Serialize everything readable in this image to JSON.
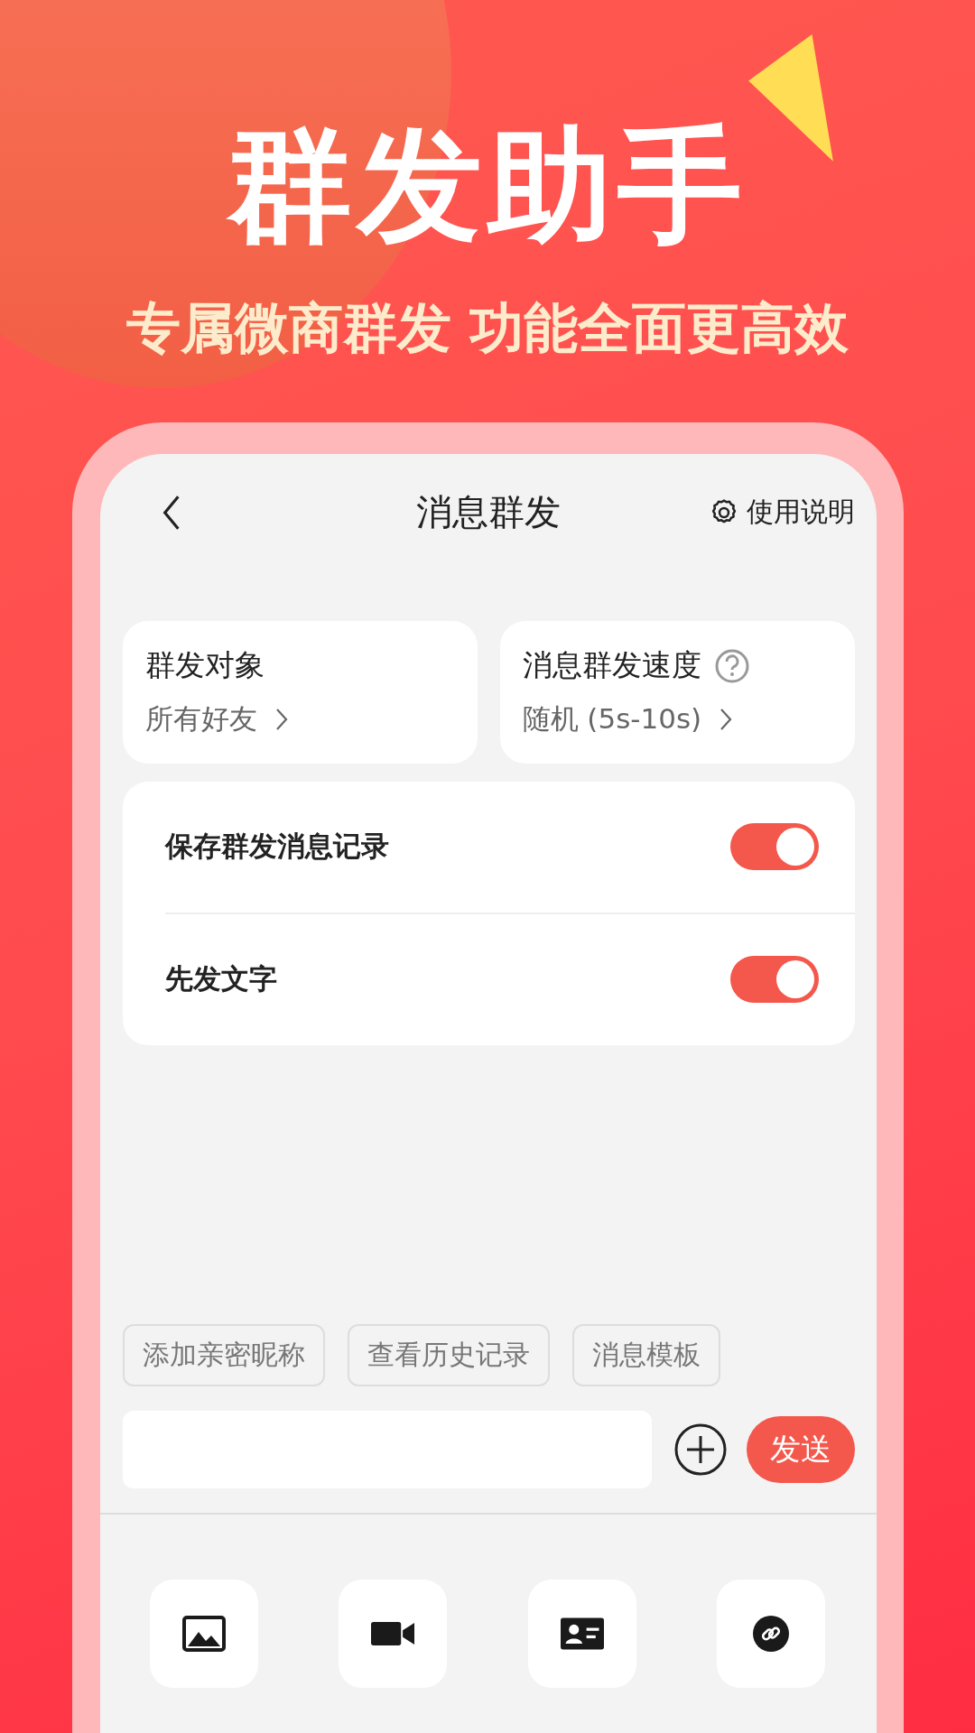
{
  "banner": {
    "headline": "群发助手",
    "subtitle": "专属微商群发 功能全面更高效"
  },
  "nav": {
    "title": "消息群发",
    "help_label": "使用说明"
  },
  "cards": [
    {
      "title": "群发对象",
      "value": "所有好友",
      "has_help": false
    },
    {
      "title": "消息群发速度",
      "value": "随机 (5s-10s)",
      "has_help": true
    }
  ],
  "toggles": [
    {
      "label": "保存群发消息记录",
      "on": true
    },
    {
      "label": "先发文字",
      "on": true
    }
  ],
  "chips": [
    "添加亲密昵称",
    "查看历史记录",
    "消息模板"
  ],
  "send_button": "发送",
  "attachments": [
    {
      "kind": "image"
    },
    {
      "kind": "video"
    },
    {
      "kind": "contact"
    },
    {
      "kind": "link"
    }
  ]
}
